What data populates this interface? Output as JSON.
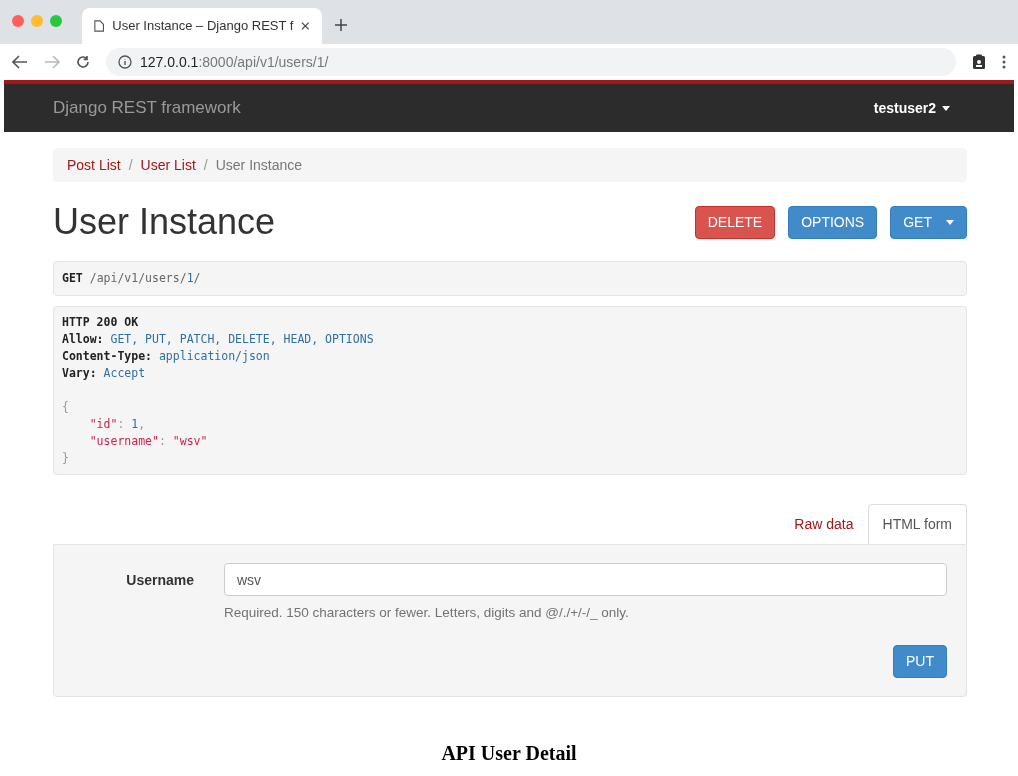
{
  "browser": {
    "tab_title": "User Instance – Django REST f",
    "url_host": "127.0.0.1",
    "url_path": ":8000/api/v1/users/1/"
  },
  "navbar": {
    "brand": "Django REST framework",
    "user": "testuser2"
  },
  "breadcrumbs": [
    {
      "label": "Post List",
      "selected": false
    },
    {
      "separator": "/",
      "label": "User List",
      "selected": false
    },
    {
      "separator": "/",
      "label": "User Instance",
      "selected": true
    }
  ],
  "title": "User Instance",
  "actions": [
    {
      "label": "DELETE",
      "kind": "danger"
    },
    {
      "label": "OPTIONS",
      "kind": "primary"
    },
    {
      "label": "GET",
      "kind": "dropdown"
    }
  ],
  "request": [
    {
      "text": "GET",
      "kind": "key"
    },
    {
      "text": " /api/v1/users/",
      "kind": "plain"
    },
    {
      "text": "1",
      "kind": "value"
    },
    {
      "text": "/",
      "kind": "plain"
    }
  ],
  "response_headers": [
    [
      {
        "text": "HTTP 200 OK",
        "kind": "key"
      }
    ],
    [
      {
        "text": "Allow:",
        "kind": "key"
      },
      {
        "text": " GET, PUT, PATCH, DELETE, HEAD, OPTIONS",
        "kind": "value"
      }
    ],
    [
      {
        "text": "Content-Type:",
        "kind": "key"
      },
      {
        "text": " application/json",
        "kind": "value"
      }
    ],
    [
      {
        "text": "Vary:",
        "kind": "key"
      },
      {
        "text": " Accept",
        "kind": "value"
      }
    ]
  ],
  "response_body": [
    [
      {
        "text": "{",
        "kind": "punct"
      }
    ],
    [
      {
        "text": "    \"id\"",
        "kind": "string"
      },
      {
        "text": ": ",
        "kind": "punct"
      },
      {
        "text": "1",
        "kind": "value"
      },
      {
        "text": ",",
        "kind": "punct"
      }
    ],
    [
      {
        "text": "    \"username\"",
        "kind": "string"
      },
      {
        "text": ": ",
        "kind": "punct"
      },
      {
        "text": "\"wsv\"",
        "kind": "string"
      }
    ],
    [
      {
        "text": "}",
        "kind": "punct"
      }
    ]
  ],
  "form_tabs": [
    {
      "label": "Raw data",
      "selected": false
    },
    {
      "label": "HTML form",
      "selected": true
    }
  ],
  "form": {
    "label": "Username",
    "value": "wsv",
    "help": "Required. 150 characters or fewer. Letters, digits and @/./+/-/_ only.",
    "submit": "PUT"
  },
  "caption": "API User Detail"
}
